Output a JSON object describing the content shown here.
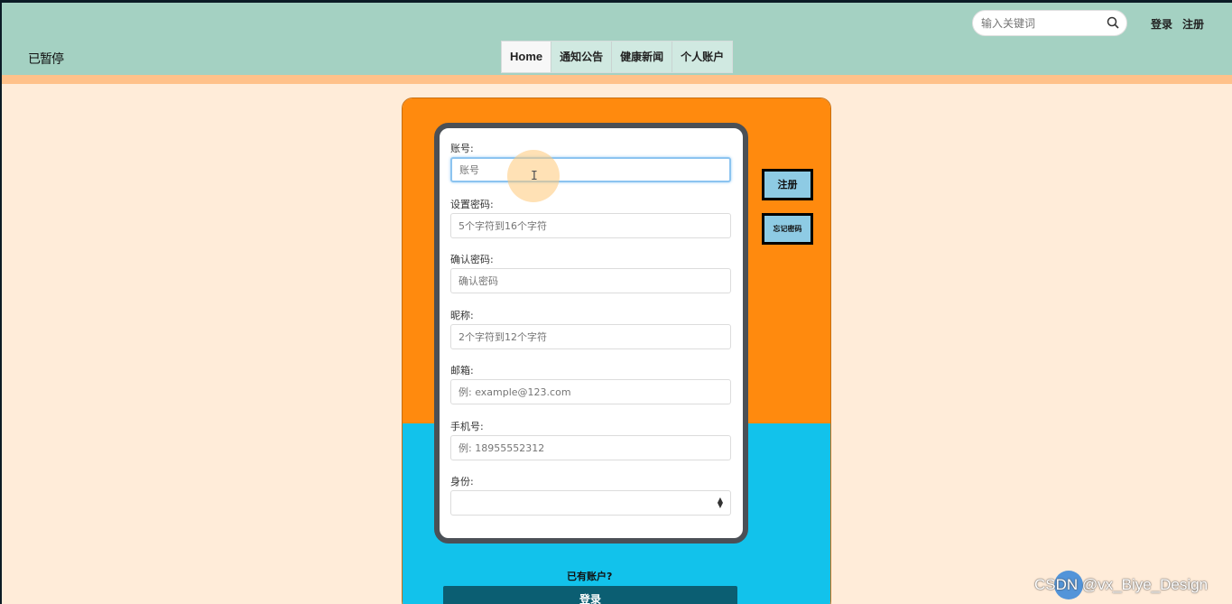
{
  "header": {
    "paused_label": "已暂停",
    "search_placeholder": "输入关键词",
    "login_link": "登录",
    "register_link": "注册"
  },
  "nav": {
    "items": [
      {
        "label": "Home"
      },
      {
        "label": "通知公告"
      },
      {
        "label": "健康新闻"
      },
      {
        "label": "个人账户"
      }
    ]
  },
  "form": {
    "account": {
      "label": "账号:",
      "placeholder": "账号"
    },
    "password": {
      "label": "设置密码:",
      "placeholder": "5个字符到16个字符"
    },
    "confirm": {
      "label": "确认密码:",
      "placeholder": "确认密码"
    },
    "nickname": {
      "label": "昵称:",
      "placeholder": "2个字符到12个字符"
    },
    "email": {
      "label": "邮箱:",
      "placeholder": "例: example@123.com"
    },
    "phone": {
      "label": "手机号:",
      "placeholder": "例: 18955552312"
    },
    "identity": {
      "label": "身份:",
      "value": ""
    }
  },
  "side": {
    "register_button": "注册",
    "forgot_button": "忘记密码"
  },
  "footer": {
    "have_account": "已有账户?",
    "login_button": "登录"
  },
  "watermark": "CSDN @vx_Biye_Design",
  "colors": {
    "header_bg": "#a4d1c2",
    "page_bg": "#ffecd9",
    "card_top": "#ff8a0e",
    "card_bottom": "#12c2eb",
    "side_button": "#8ecbe4",
    "login_bar": "#0b5e72"
  }
}
